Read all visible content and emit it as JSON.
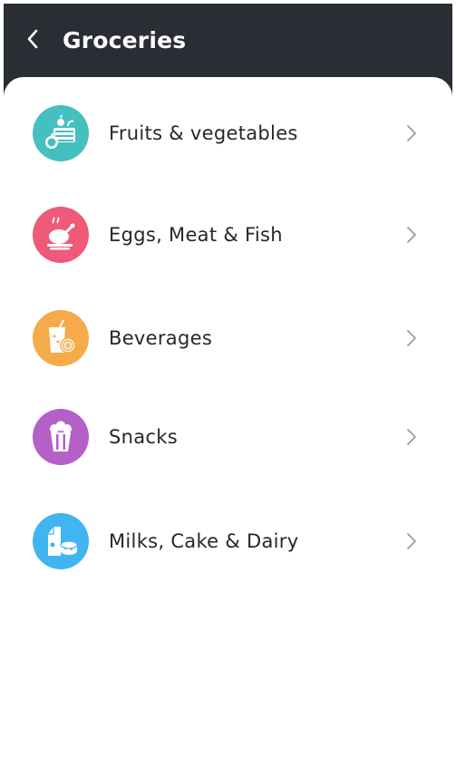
{
  "header": {
    "title": "Groceries",
    "back_icon": "chevron-left-icon",
    "bg_color": "#2a2d34"
  },
  "categories": [
    {
      "label": "Fruits & vegetables",
      "icon": "produce-basket-icon",
      "color": "#45bfc0"
    },
    {
      "label": "Eggs, Meat & Fish",
      "icon": "roast-chicken-icon",
      "color": "#ee5a78"
    },
    {
      "label": "Beverages",
      "icon": "juice-glass-icon",
      "color": "#f6ab4a"
    },
    {
      "label": "Snacks",
      "icon": "popcorn-icon",
      "color": "#b560c9"
    },
    {
      "label": "Milks, Cake & Dairy",
      "icon": "milk-carton-icon",
      "color": "#41b4f2"
    }
  ],
  "row_chevron_icon": "chevron-right-icon"
}
